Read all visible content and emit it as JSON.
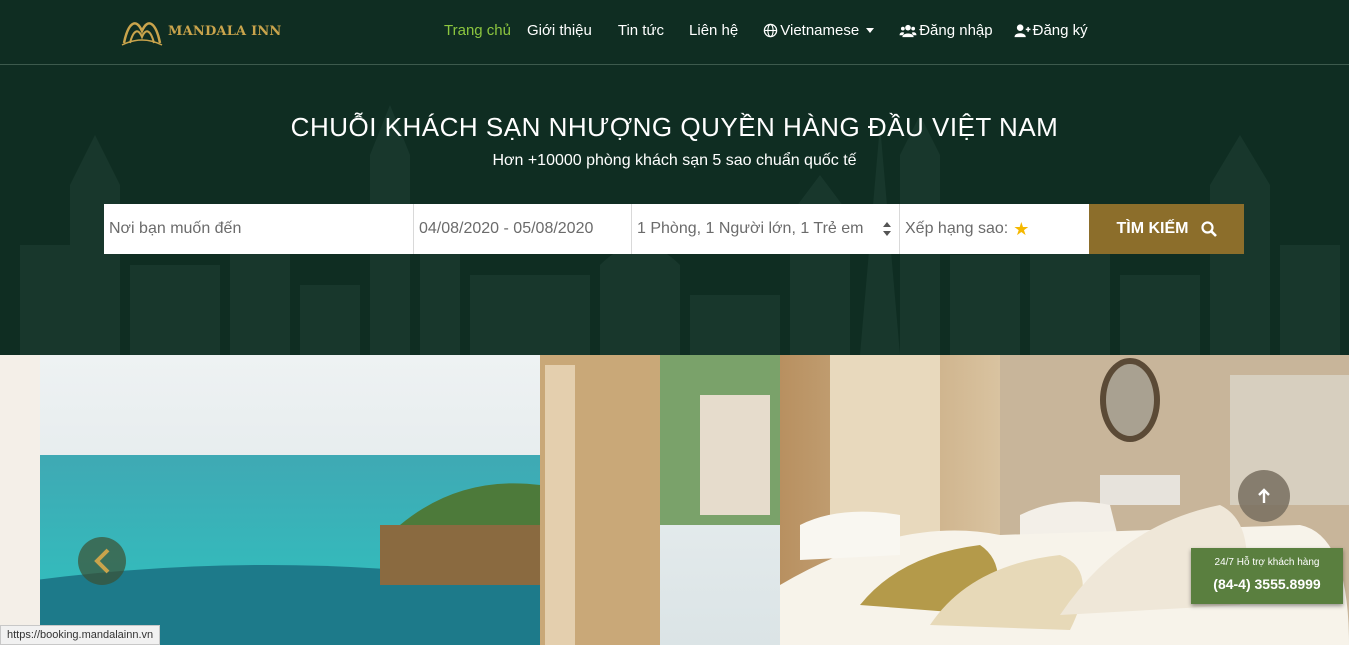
{
  "brand": {
    "name": "MANDALA INN"
  },
  "nav": {
    "home": "Trang chủ",
    "about": "Giới thiệu",
    "news": "Tin tức",
    "contact": "Liên hệ",
    "language": "Vietnamese",
    "login": "Đăng nhập",
    "register": "Đăng ký"
  },
  "hero": {
    "title": "CHUỖI KHÁCH SẠN NHƯỢNG QUYỀN HÀNG ĐẦU VIỆT NAM",
    "subtitle": "Hơn +10000 phòng khách sạn 5 sao chuẩn quốc tế"
  },
  "search": {
    "destination_placeholder": "Nơi bạn muốn đến",
    "dates": "04/08/2020 - 05/08/2020",
    "guests": "1 Phòng, 1 Người lớn, 1 Trẻ em",
    "rating_label": "Xếp hạng sao:",
    "button": "TÌM KIẾM"
  },
  "support": {
    "line1": "24/7 Hỗ trợ khách hàng",
    "phone": "(84-4) 3555.8999"
  },
  "status_url": "https://booking.mandalainn.vn",
  "colors": {
    "background": "#0f2d22",
    "active_nav": "#8cc63f",
    "accent_gold": "#8c6e2b",
    "support_green": "#5a7f3f"
  },
  "icons": [
    "globe-icon",
    "users-icon",
    "user-plus-icon",
    "search-icon",
    "star-icon",
    "chevron-left-icon",
    "arrow-up-icon"
  ]
}
